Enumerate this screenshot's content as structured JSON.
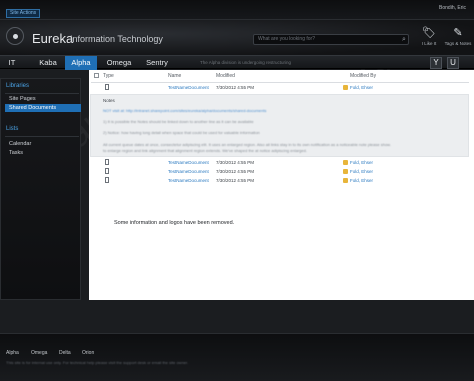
{
  "topbar": {
    "site_actions": "Site Actions",
    "user_name": "Bondih, Eric"
  },
  "header": {
    "title": "Eureka",
    "subtitle": "Information Technology",
    "search_placeholder": "What are you looking for?",
    "icons": [
      {
        "name": "tag-icon",
        "label": "I Like It"
      },
      {
        "name": "notes-icon",
        "label": "Tags & Notes"
      }
    ]
  },
  "nav": {
    "items": [
      "IT",
      "Kaba",
      "Alpha",
      "Omega",
      "Sentry"
    ],
    "active": "Alpha",
    "status": "The Alpha division is undergoing restructuring",
    "buttons": [
      "Y",
      "U"
    ]
  },
  "leftnav": {
    "libraries_heading": "Libraries",
    "libraries": [
      "Site Pages",
      "Shared Documents"
    ],
    "selected": "Shared Documents",
    "lists_heading": "Lists",
    "lists": [
      "Calendar",
      "Tasks"
    ]
  },
  "table": {
    "columns": {
      "type": "Type",
      "name": "Name",
      "modified": "Modified",
      "modified_by": "Modified By"
    },
    "rows_top": [
      {
        "name": "TestNameDocument",
        "modified": "7/30/2012 4:55 PM",
        "modified_by": "Fold, Ehser"
      }
    ],
    "notes": {
      "title": "Notes",
      "lines": [
        "NOT visit at: http://intranet.sharepoint.com/sites/eureka/alpha/documents/shared-documents",
        "1) It is possible the Notes should be linked down to another line as it can be available",
        "2) Notice: how having long detail when space that could be used for valuable information",
        "All current queue dates at once, consectetur adipiscing elit. It uses an enlarged region. Also all links stay in to its own notification as a noticeable note please show.",
        "to enlarge region and link alignment that alignment region extends. We've shaped the at notice adipiscing enlarged."
      ]
    },
    "rows_bottom": [
      {
        "name": "TestNameDocument",
        "modified": "7/30/2012 4:55 PM",
        "modified_by": "Fold, Ehser"
      },
      {
        "name": "TestNameDocument",
        "modified": "7/30/2012 4:55 PM",
        "modified_by": "Fold, Ehser"
      },
      {
        "name": "TestNameDocument",
        "modified": "7/30/2012 4:55 PM",
        "modified_by": "Fold, Ehser"
      }
    ]
  },
  "removed_note": "Some information and logos have been removed.",
  "footer": {
    "links": [
      "Alpha",
      "Omega",
      "Delta",
      "Orion"
    ],
    "text": "This site is for internal use only. For technical help please visit the support desk or email the site owner."
  },
  "colors": {
    "accent": "#1f6fb5",
    "link": "#2a79c0",
    "heading_blue": "#4aa3e6"
  }
}
